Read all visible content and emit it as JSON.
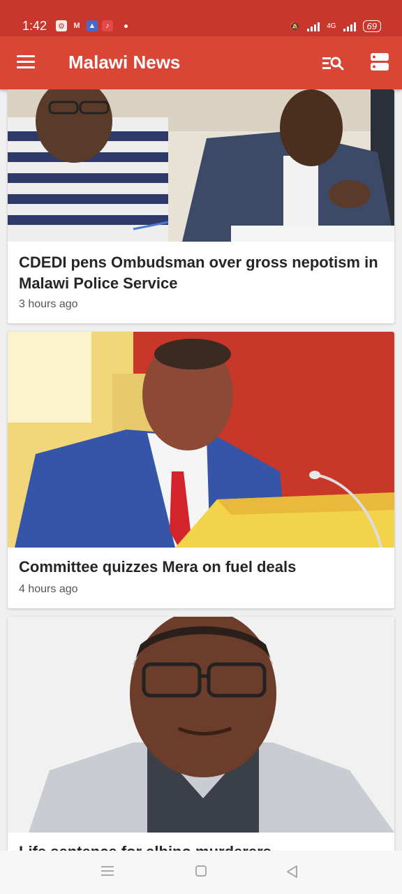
{
  "status_bar": {
    "time": "1:42",
    "network": "4G",
    "battery": "69"
  },
  "app_bar": {
    "title": "Malawi News"
  },
  "feed": {
    "articles": [
      {
        "title": "CDEDI pens Ombudsman over gross nepotism in Malawi Police Service",
        "time": "3 hours ago"
      },
      {
        "title": "Committee quizzes Mera on fuel deals",
        "time": "4 hours ago"
      },
      {
        "title": "Life sentence for albino murderers",
        "time": ""
      }
    ]
  },
  "colors": {
    "status_bar": "#c9372c",
    "app_bar": "#d94636",
    "background": "#efefef"
  }
}
